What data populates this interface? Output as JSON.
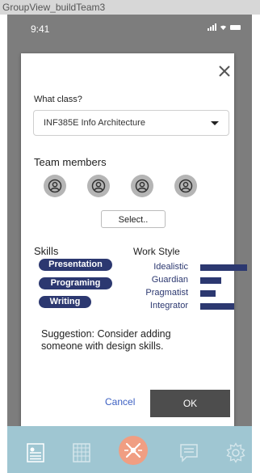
{
  "window": {
    "title": "GroupView_buildTeam3"
  },
  "status": {
    "time": "9:41"
  },
  "modal": {
    "class_label": "What class?",
    "class_value": "INF385E Info Architecture",
    "team_label": "Team members",
    "select_button": "Select..",
    "skills_label": "Skills",
    "skills": [
      "Presentation",
      "Programing",
      "Writing"
    ],
    "work_style_label": "Work Style",
    "work_style": [
      {
        "label": "Idealistic",
        "level": 1.0
      },
      {
        "label": "Guardian",
        "level": 0.45
      },
      {
        "label": "Pragmatist",
        "level": 0.32
      },
      {
        "label": "Integrator",
        "level": 0.72
      }
    ],
    "suggestion": "Suggestion: Consider adding someone with design skills.",
    "cancel": "Cancel",
    "ok": "OK"
  },
  "colors": {
    "accent": "#2c3870",
    "tabbar": "#9fc6d2",
    "center_tab": "#f09e82",
    "overlay": "#7d7d7d",
    "ok_button": "#4d4d4d",
    "cancel_link": "#3b5fc2"
  },
  "tabbar": {
    "items": [
      "profile-card-icon",
      "calendar-grid-icon",
      "tools-icon",
      "chat-icon",
      "gear-icon"
    ]
  }
}
